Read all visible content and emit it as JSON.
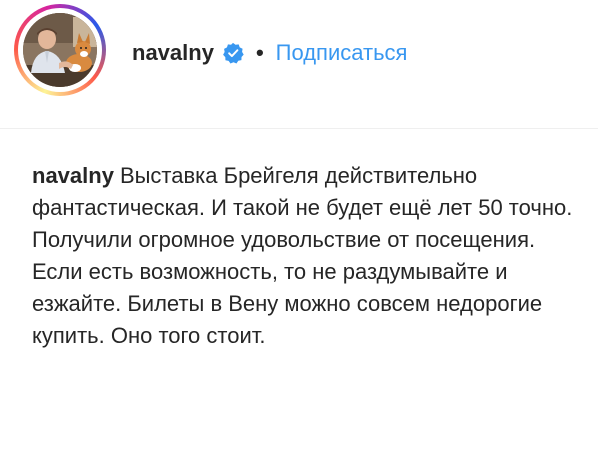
{
  "post": {
    "username": "navalny",
    "separator": "•",
    "follow_label": "Подписаться",
    "verified_icon": "verified-badge-icon",
    "accent_color": "#3897f0",
    "verified_color": "#3897f0"
  },
  "caption": {
    "username": "navalny",
    "text": "Выставка Брейгеля действительно фантастическая. И такой не будет ещё лет 50 точно. Получили огромное удовольствие от посещения. Если есть возможность, то не раздумывайте и езжайте. Билеты в Вену можно совсем недорогие купить. Оно того стоит."
  }
}
